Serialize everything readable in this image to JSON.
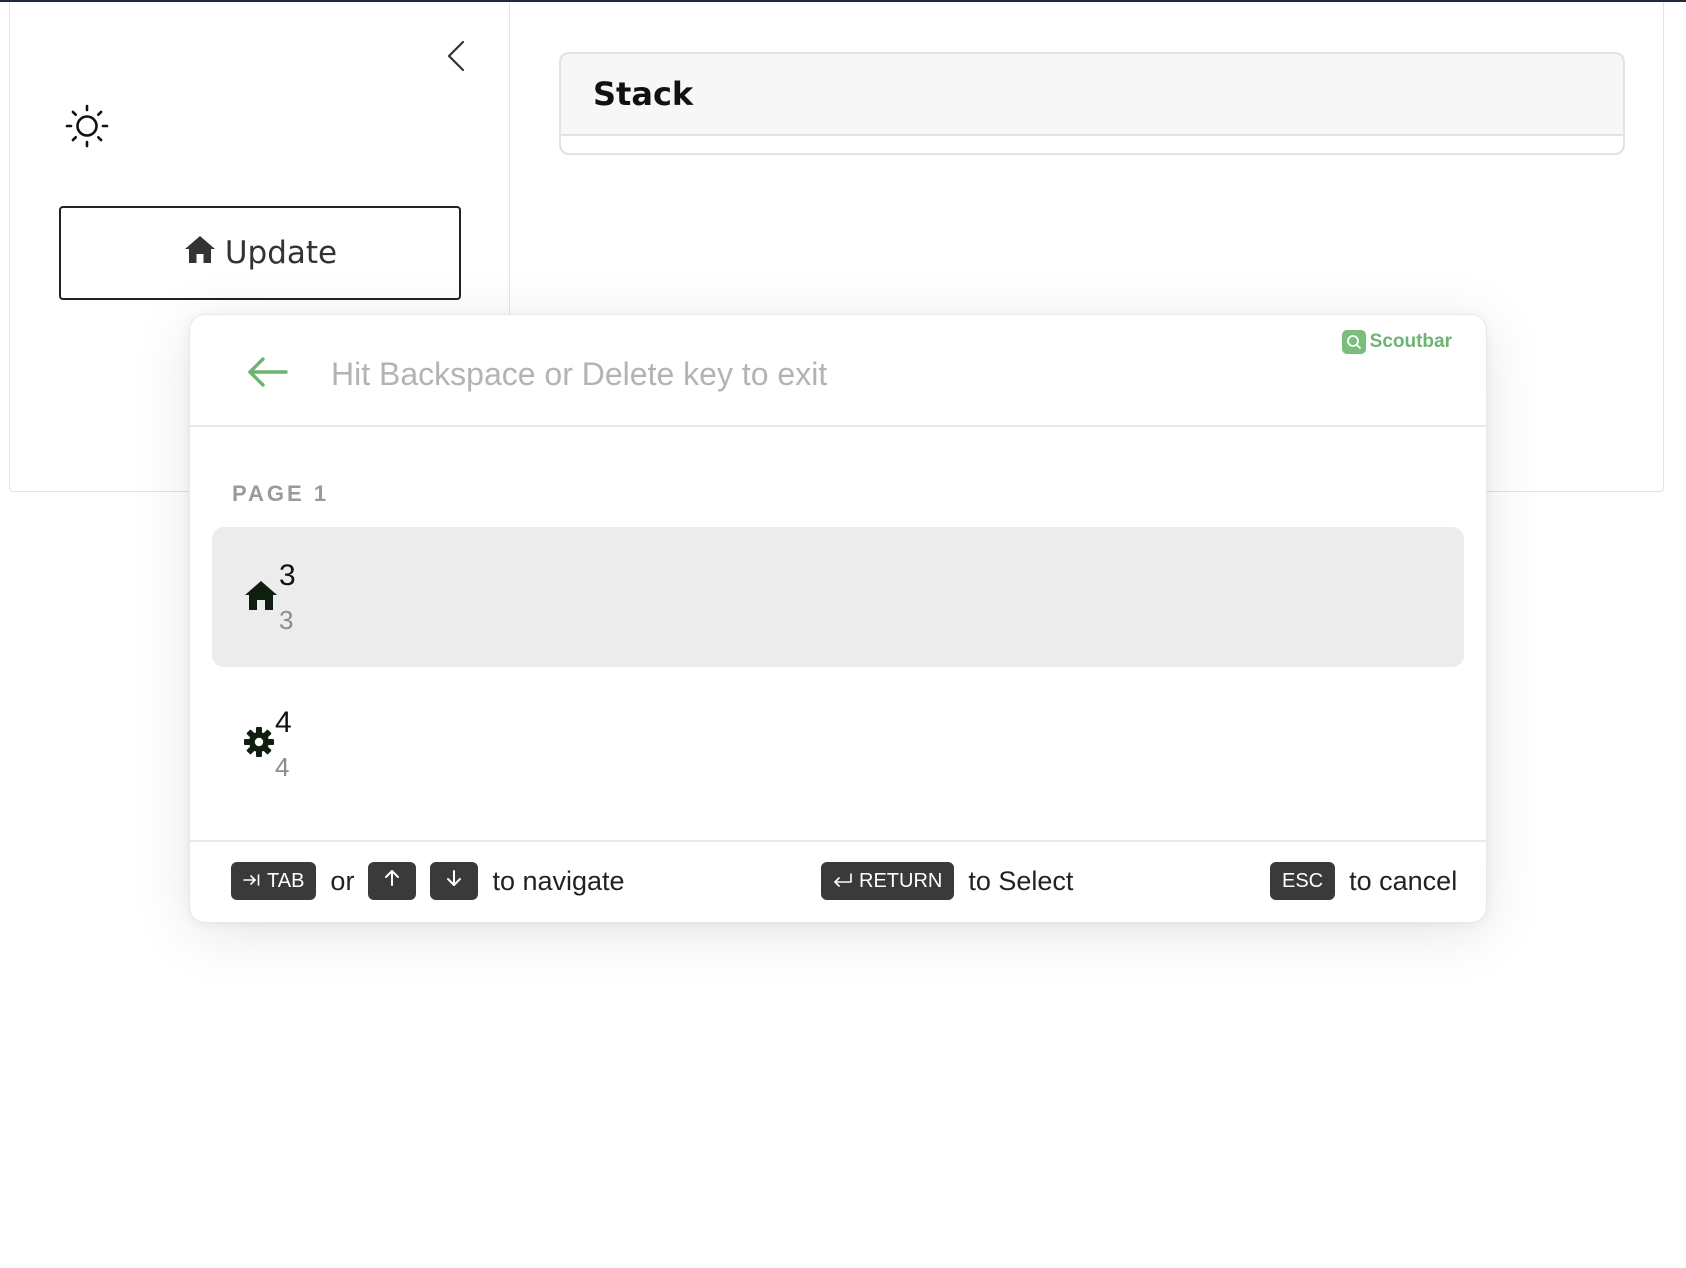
{
  "sidebar": {
    "update_button_label": "Update"
  },
  "main": {
    "stack_title": "Stack"
  },
  "scoutbar": {
    "brand": "Scoutbar",
    "search_placeholder": "Hit Backspace or Delete key to exit",
    "section_label": "PAGE 1",
    "results": [
      {
        "title": "3",
        "subtitle": "3",
        "icon": "home-icon",
        "active": true
      },
      {
        "title": "4",
        "subtitle": "4",
        "icon": "gear-icon",
        "active": false
      }
    ],
    "footer": {
      "tab_key": "TAB",
      "or_text": "or",
      "navigate_text": "to navigate",
      "return_key": "RETURN",
      "select_text": "to Select",
      "esc_key": "ESC",
      "cancel_text": "to cancel"
    }
  },
  "colors": {
    "accent_green": "#6cb46f",
    "active_row": "#ececec",
    "kbd_bg": "#3a3a3a"
  }
}
